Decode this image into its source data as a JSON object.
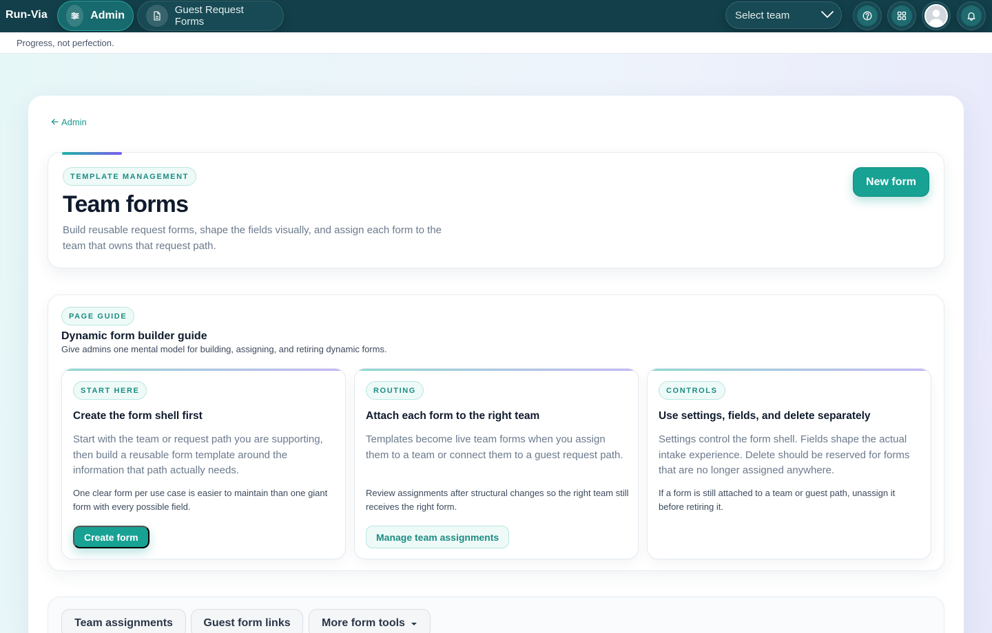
{
  "app": {
    "brand": "Run-Via"
  },
  "nav": {
    "tabs": [
      {
        "label": "Admin",
        "icon": "sliders-icon",
        "active": true
      },
      {
        "label": "Guest Request Forms",
        "icon": "document-icon",
        "active": false
      }
    ]
  },
  "header": {
    "team_select": {
      "value": "Select team"
    },
    "icons": [
      "help-icon",
      "apps-grid-icon",
      "avatar",
      "bell-icon"
    ]
  },
  "subbar": {
    "motto": "Progress, not perfection."
  },
  "breadcrumb": {
    "back_label": "Admin"
  },
  "hero": {
    "tag": "TEMPLATE MANAGEMENT",
    "title": "Team forms",
    "description": "Build reusable request forms, shape the fields visually, and assign each form to the team that owns that request path.",
    "new_form_label": "New form"
  },
  "guide": {
    "tag": "PAGE GUIDE",
    "title": "Dynamic form builder guide",
    "subtitle": "Give admins one mental model for building, assigning, and retiring dynamic forms.",
    "cards": [
      {
        "tag": "START HERE",
        "title": "Create the form shell first",
        "body": "Start with the team or request path you are supporting, then build a reusable form template around the information that path actually needs.",
        "note": "One clear form per use case is easier to maintain than one giant form with every possible field.",
        "button": "Create form"
      },
      {
        "tag": "ROUTING",
        "title": "Attach each form to the right team",
        "body": "Templates become live team forms when you assign them to a team or connect them to a guest request path.",
        "note": "Review assignments after structural changes so the right team still receives the right form.",
        "button": "Manage team assignments"
      },
      {
        "tag": "CONTROLS",
        "title": "Use settings, fields, and delete separately",
        "body": "Settings control the form shell. Fields shape the actual intake experience. Delete should be reserved for forms that are no longer assigned anywhere.",
        "note": "If a form is still attached to a team or guest path, unassign it before retiring it."
      }
    ]
  },
  "tools": {
    "tabs": [
      "Team assignments",
      "Guest form links",
      "More form tools"
    ]
  },
  "colors": {
    "topbar": "#123f4a",
    "accent": "#17a294",
    "accent_light": "#eefaf8"
  }
}
